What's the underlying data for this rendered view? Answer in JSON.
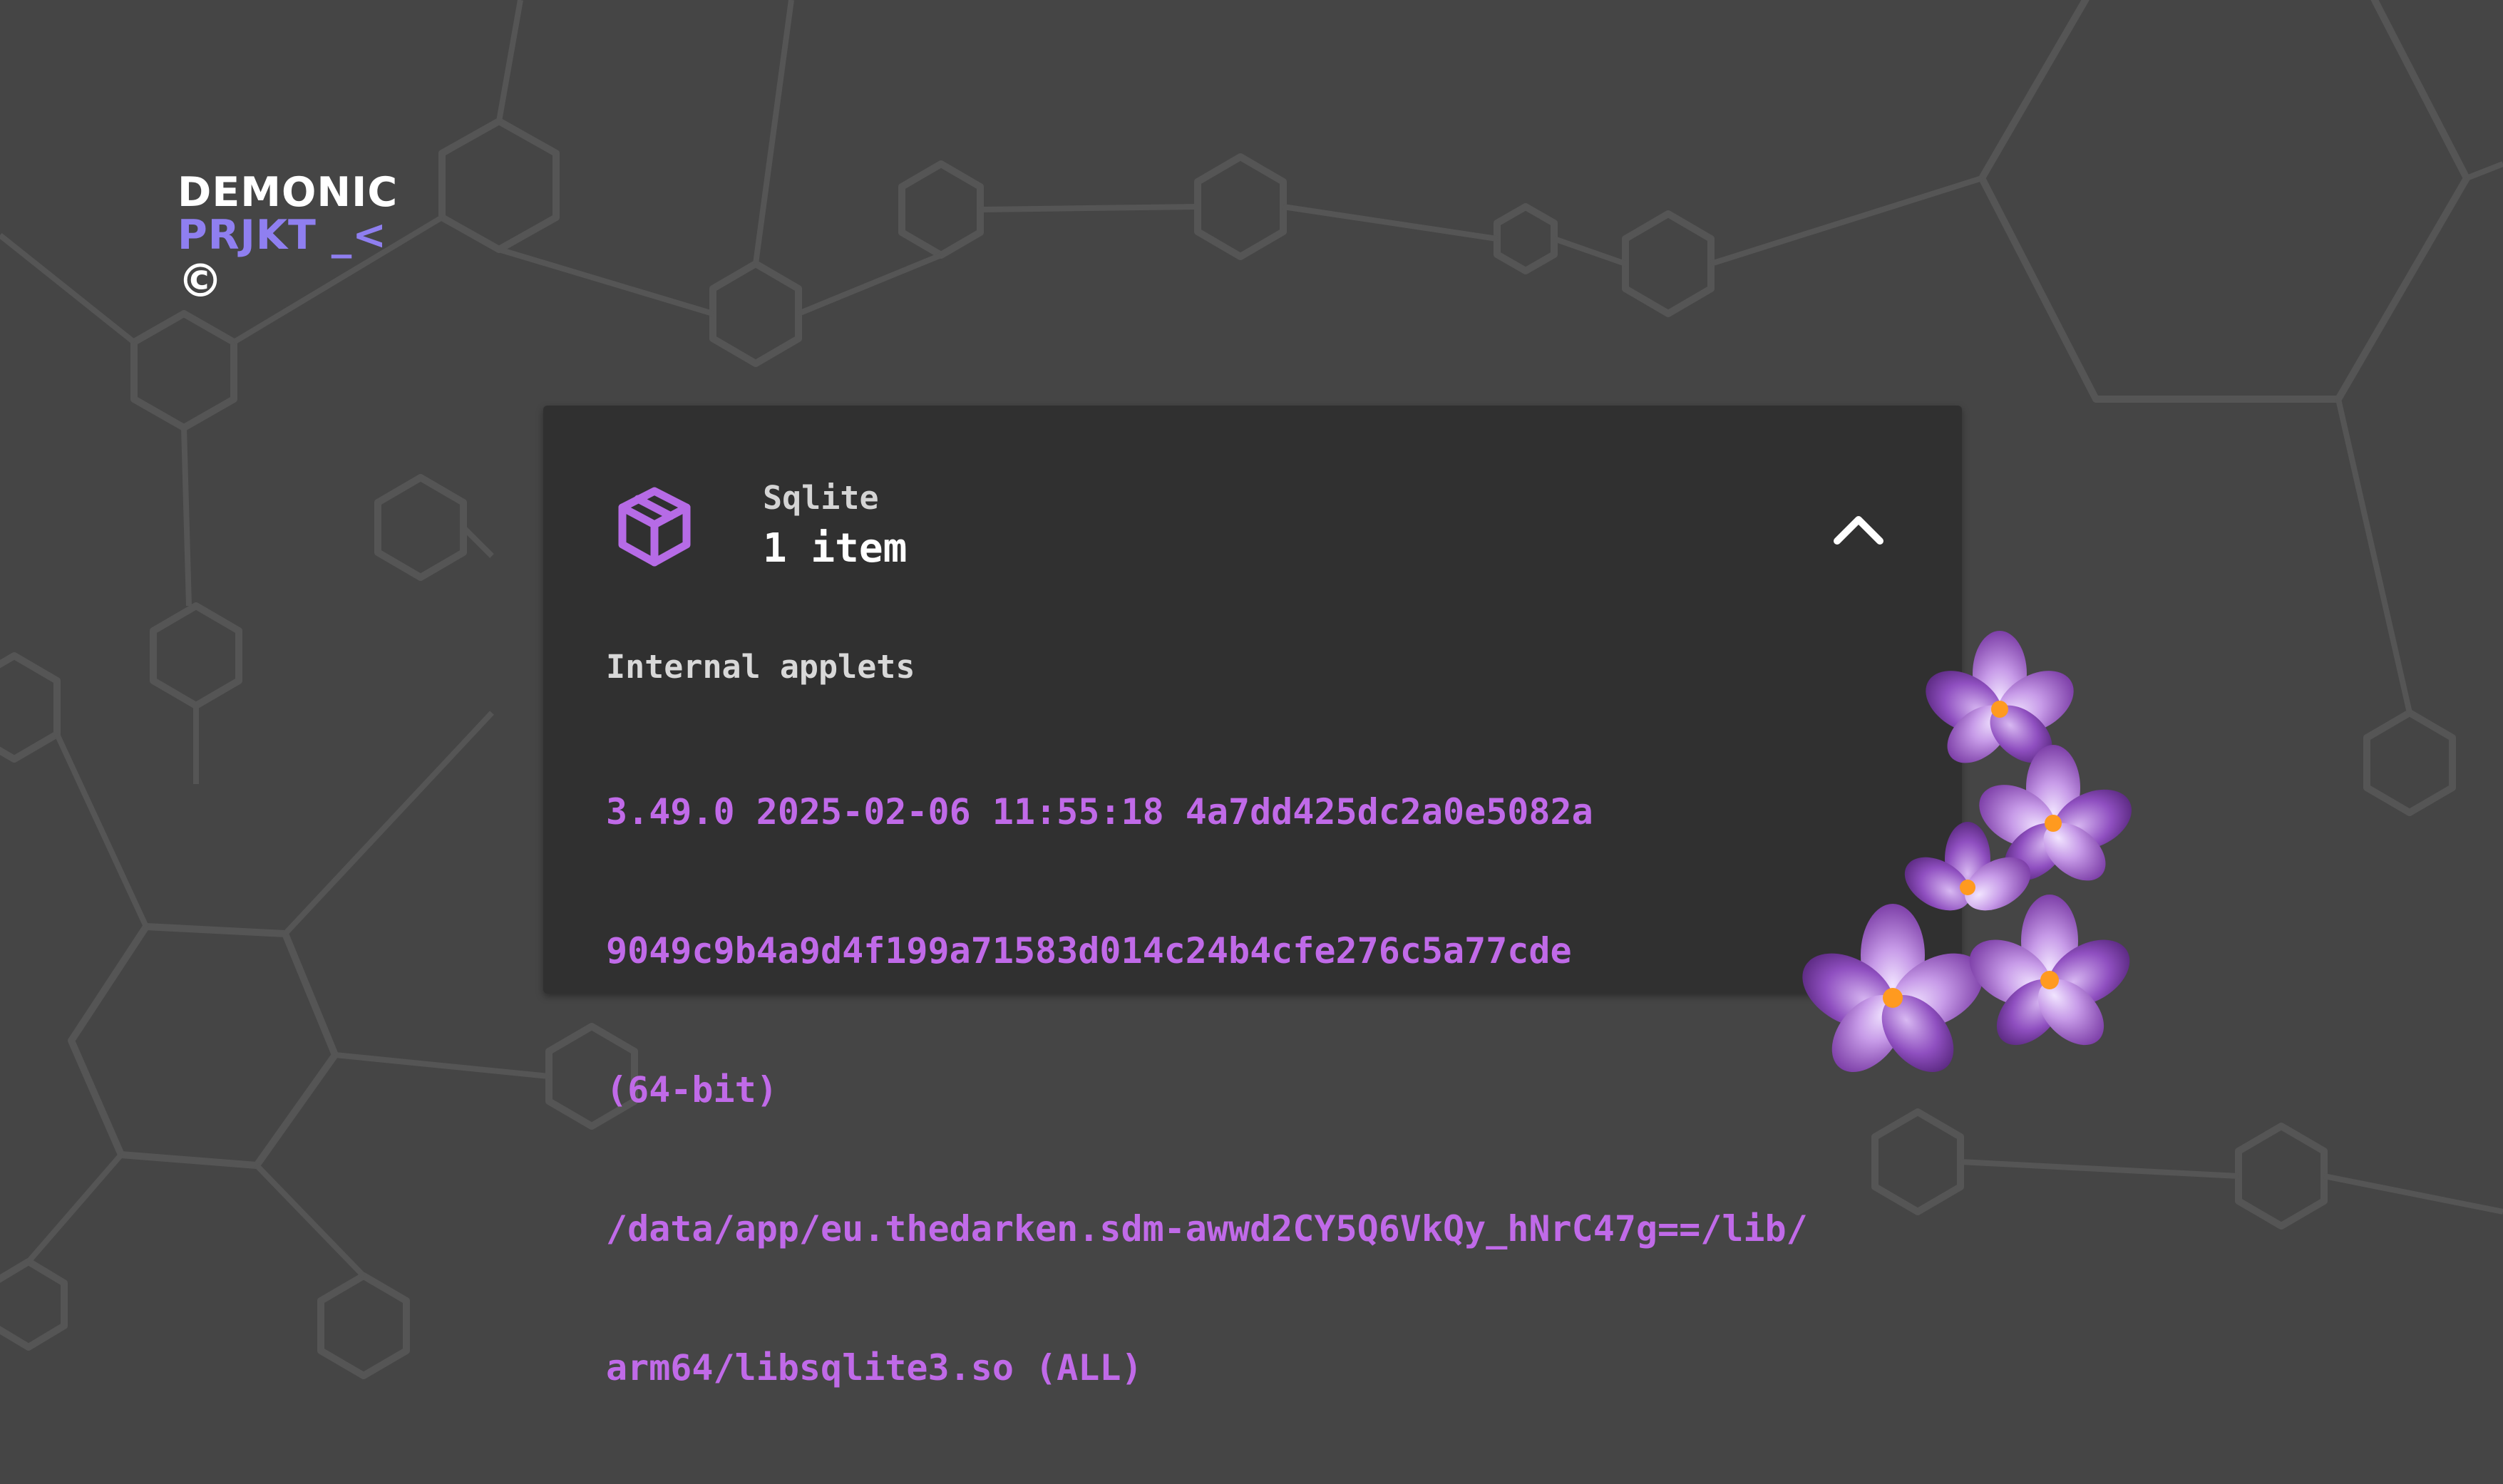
{
  "brand": {
    "line1": "DEMONIC",
    "line2": "PRJKT _<",
    "copyright": "©"
  },
  "card": {
    "icon": "package-cube-icon",
    "subtitle": "Sqlite",
    "title": "1 item",
    "collapse_icon": "chevron-up-icon",
    "section_label": "Internal applets",
    "applet_lines": [
      "3.49.0 2025-02-06 11:55:18 4a7dd425dc2a0e5082a",
      "9049c9b4a9d4f199a71583d014c24b4cfe276c5a77cde",
      "(64-bit)",
      "/data/app/eu.thedarken.sdm-awwd2CY5Q6VkQy_hNrC47g==/lib/",
      "arm64/libsqlite3.so (ALL)"
    ]
  },
  "colors": {
    "background": "#454545",
    "card": "#303030",
    "accent_purple": "#c06ae8",
    "brand_purple": "#8f7ff0",
    "icon_purple": "#b66be6"
  }
}
